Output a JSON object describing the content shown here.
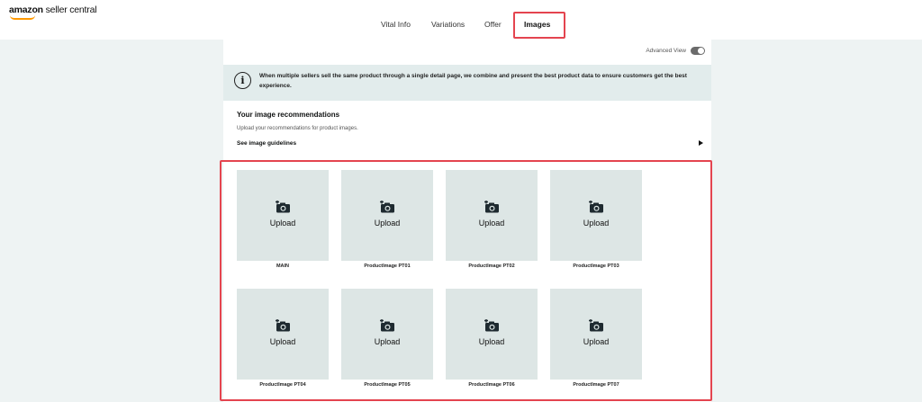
{
  "header": {
    "logo_brand": "amazon",
    "logo_rest": " seller central"
  },
  "tabs": [
    {
      "label": "Vital Info",
      "active": false
    },
    {
      "label": "Variations",
      "active": false
    },
    {
      "label": "Offer",
      "active": false
    },
    {
      "label": "Images",
      "active": true
    }
  ],
  "panel": {
    "advanced_view_label": "Advanced View",
    "notice": "When multiple sellers sell the same product through a single detail page, we combine and present the best product data to ensure customers get the best experience.",
    "recommendations_title": "Your image recommendations",
    "recommendations_subtitle": "Upload your recommendations for product images.",
    "guidelines_link": "See image guidelines"
  },
  "slots": [
    {
      "label": "MAIN",
      "upload": "Upload",
      "icon": "camera-plus-icon"
    },
    {
      "label": "ProductImage PT01",
      "upload": "Upload",
      "icon": "camera-plus-icon"
    },
    {
      "label": "ProductImage PT02",
      "upload": "Upload",
      "icon": "camera-plus-icon"
    },
    {
      "label": "ProductImage PT03",
      "upload": "Upload",
      "icon": "camera-plus-icon"
    },
    {
      "label": "ProductImage PT04",
      "upload": "Upload",
      "icon": "camera-plus-icon"
    },
    {
      "label": "ProductImage PT05",
      "upload": "Upload",
      "icon": "camera-plus-icon"
    },
    {
      "label": "ProductImage PT06",
      "upload": "Upload",
      "icon": "camera-plus-icon"
    },
    {
      "label": "ProductImage PT07",
      "upload": "Upload",
      "icon": "camera-plus-icon"
    }
  ],
  "colors": {
    "highlight": "#e4444f",
    "tile": "#dde6e5",
    "notice_bg": "#e2ecec",
    "page_bg": "#eef3f3",
    "logo_smile": "#ff9900"
  }
}
